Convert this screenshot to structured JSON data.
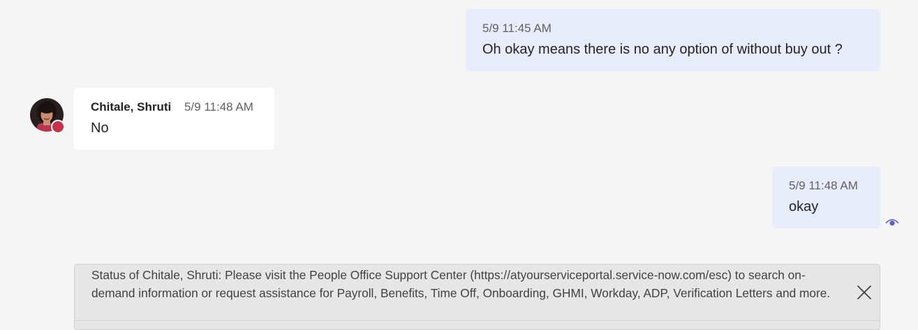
{
  "messages": [
    {
      "id": "msg-1",
      "author": "me",
      "timestamp": "5/9 11:45 AM",
      "text": "Oh okay means there is no any option of without buy out ?"
    },
    {
      "id": "msg-2",
      "author": "other",
      "sender": "Chitale, Shruti",
      "timestamp": "5/9 11:48 AM",
      "text": "No"
    },
    {
      "id": "msg-3",
      "author": "me",
      "timestamp": "5/9 11:48 AM",
      "text": "okay"
    }
  ],
  "avatar": {
    "presence": "busy",
    "presence_color": "#c4314b"
  },
  "read_receipt": {
    "icon": "eye-icon",
    "color": "#5b5fc7"
  },
  "status_banner": {
    "text": "Status of Chitale, Shruti: Please visit the People Office Support Center (https://atyourserviceportal.service-now.com/esc) to search on-demand information or request assistance for Payroll, Benefits, Time Off, Onboarding, GHMI, Workday, ADP, Verification Letters and more.",
    "close_icon": "close-icon"
  },
  "colors": {
    "background": "#f5f5f5",
    "my_bubble": "#e8ebfa",
    "their_bubble": "#ffffff",
    "banner": "#e6e6e6"
  }
}
